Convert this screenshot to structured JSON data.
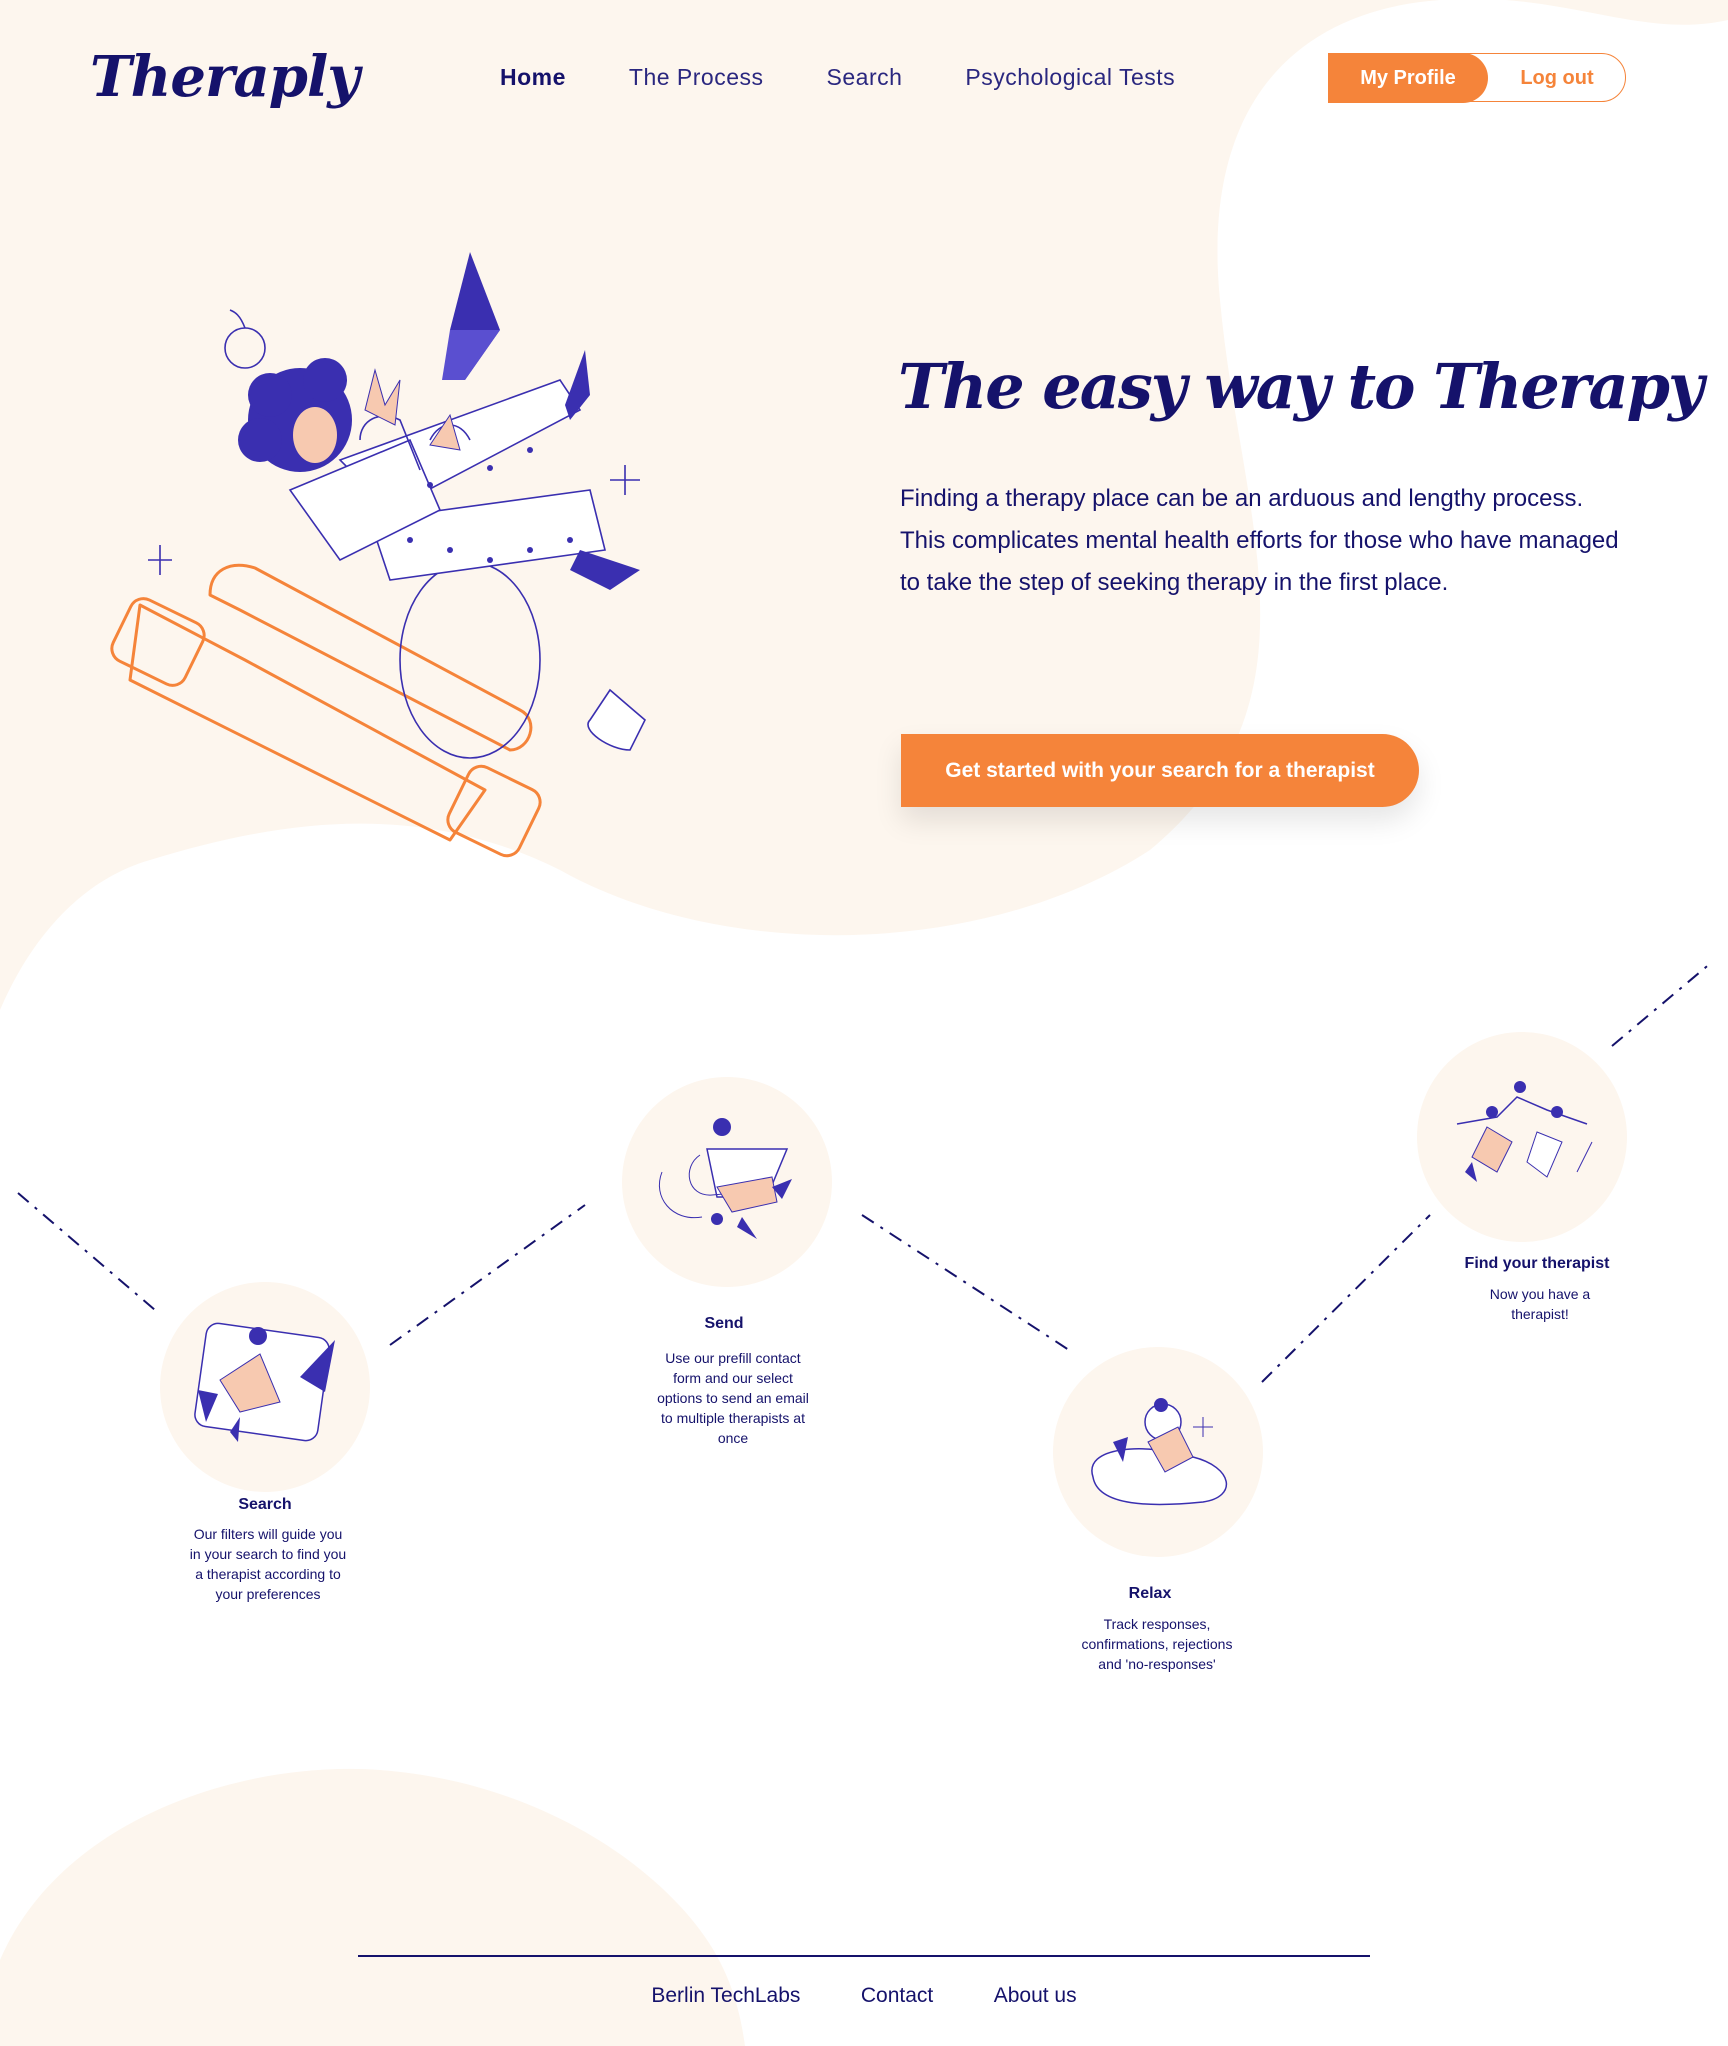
{
  "brand": {
    "logo": "Theraply",
    "accent": "#f5843a",
    "navy": "#15126b",
    "cream": "#fdf6ee"
  },
  "nav": {
    "items": [
      "Home",
      "The Process",
      "Search",
      "Psychological Tests"
    ],
    "active": "Home"
  },
  "auth": {
    "profile_label": "My Profile",
    "logout_label": "Log out"
  },
  "hero": {
    "title": "The easy way to Therapy",
    "text": "Finding a therapy place can be an arduous and lengthy process. This complicates mental health efforts for those who have managed to take the step of seeking therapy in the first place.",
    "cta_label": "Get started with your search for a therapist"
  },
  "steps": [
    {
      "title": "Search",
      "desc": "Our filters will guide you in your search to find you a therapist according to your preferences",
      "icon": "laptop-person-icon"
    },
    {
      "title": "Send",
      "desc": "Use our prefill contact form and our select options to send an email to multiple therapists at once",
      "icon": "envelope-person-icon"
    },
    {
      "title": "Relax",
      "desc": "Track responses, confirmations, rejections and 'no-responses'",
      "icon": "relax-person-icon"
    },
    {
      "title": "Find your therapist",
      "desc": "Now you have a therapist!",
      "icon": "people-holding-hands-icon"
    }
  ],
  "footer": {
    "links": [
      "Berlin TechLabs",
      "Contact",
      "About us"
    ]
  }
}
